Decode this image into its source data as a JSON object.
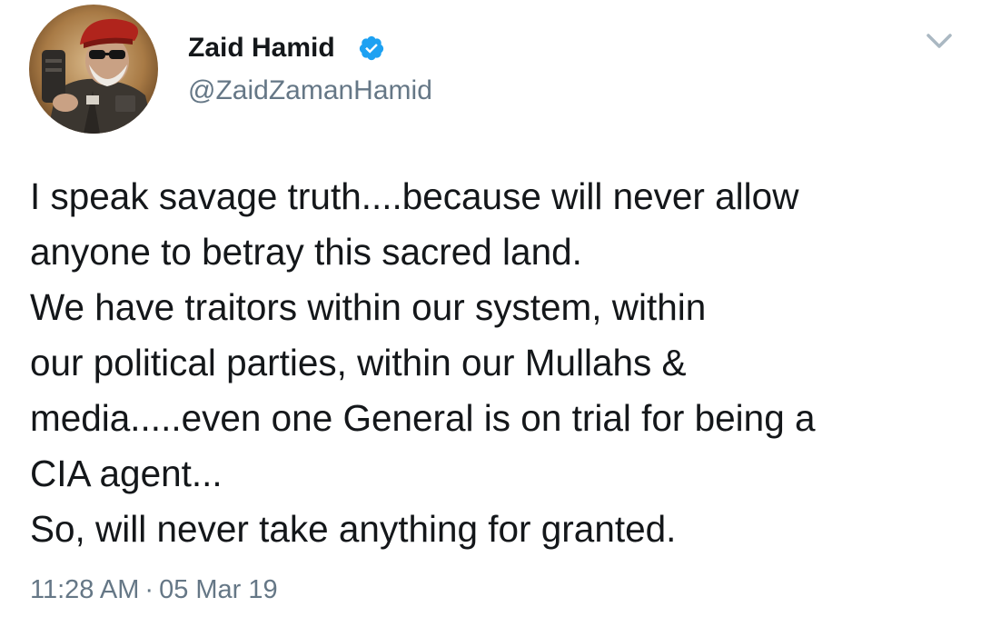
{
  "colors": {
    "name_text": "#14171a",
    "secondary_text": "#657786",
    "verified_badge": "#1da1f2",
    "chevron": "#aab8c2",
    "beret": "#b0241c"
  },
  "tweet": {
    "author": {
      "display_name": "Zaid Hamid",
      "handle": "@ZaidZamanHamid",
      "verified": true,
      "verified_icon": "verified-badge-icon",
      "avatar_icon": "profile-avatar"
    },
    "menu_icon": "chevron-down-icon",
    "body_lines": [
      "I speak savage truth....because will never allow",
      "anyone to betray this sacred land.",
      "We have traitors within our system, within",
      "our political parties, within our Mullahs &",
      "media.....even one General is on trial for being a",
      "CIA agent...",
      "So, will never take anything for granted."
    ],
    "time": "11:28 AM",
    "separator": "·",
    "date": "05 Mar 19"
  }
}
